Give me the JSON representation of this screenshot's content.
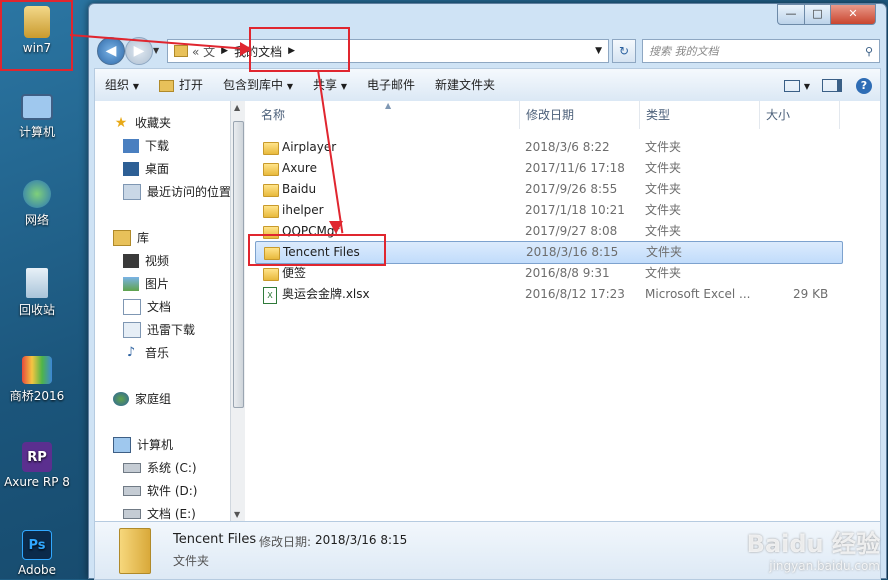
{
  "desktop": {
    "icons": [
      {
        "label": "win7",
        "icon": "user-folder-icon"
      },
      {
        "label": "计算机",
        "icon": "computer-icon"
      },
      {
        "label": "网络",
        "icon": "network-icon"
      },
      {
        "label": "回收站",
        "icon": "recycle-bin-icon"
      },
      {
        "label": "商桥2016",
        "icon": "shangqiao-icon"
      },
      {
        "label": "Axure RP 8",
        "icon": "axure-icon"
      },
      {
        "label": "Adobe",
        "icon": "adobe-icon"
      }
    ]
  },
  "window": {
    "address": {
      "prefix": "« 文",
      "current": "我的文档"
    },
    "search_placeholder": "搜索 我的文档",
    "toolbar": {
      "organize": "组织",
      "open": "打开",
      "include_library": "包含到库中",
      "share": "共享",
      "email": "电子邮件",
      "new_folder": "新建文件夹"
    },
    "nav": {
      "favorites": "收藏夹",
      "download": "下载",
      "desktop": "桌面",
      "recent": "最近访问的位置",
      "libraries": "库",
      "video": "视频",
      "pictures": "图片",
      "documents": "文档",
      "xunlei": "迅雷下载",
      "music": "音乐",
      "homegroup": "家庭组",
      "computer": "计算机",
      "drive_c": "系统 (C:)",
      "drive_d": "软件 (D:)",
      "drive_e": "文档 (E:)"
    },
    "columns": {
      "name": "名称",
      "modified": "修改日期",
      "type": "类型",
      "size": "大小"
    },
    "files": [
      {
        "name": "Airplayer",
        "date": "2018/3/6 8:22",
        "type": "文件夹",
        "size": ""
      },
      {
        "name": "Axure",
        "date": "2017/11/6 17:18",
        "type": "文件夹",
        "size": ""
      },
      {
        "name": "Baidu",
        "date": "2017/9/26 8:55",
        "type": "文件夹",
        "size": ""
      },
      {
        "name": "ihelper",
        "date": "2017/1/18 10:21",
        "type": "文件夹",
        "size": ""
      },
      {
        "name": "QQPCMgr",
        "date": "2017/9/27 8:08",
        "type": "文件夹",
        "size": ""
      },
      {
        "name": "Tencent Files",
        "date": "2018/3/16 8:15",
        "type": "文件夹",
        "size": ""
      },
      {
        "name": "便签",
        "date": "2016/8/8 9:31",
        "type": "文件夹",
        "size": ""
      },
      {
        "name": "奥运会金牌.xlsx",
        "date": "2016/8/12 17:23",
        "type": "Microsoft Excel ...",
        "size": "29 KB"
      }
    ],
    "details": {
      "name": "Tencent Files",
      "modified_label": "修改日期:",
      "modified_value": "2018/3/16 8:15",
      "type": "文件夹"
    }
  },
  "watermark": {
    "brand": "Baidu 经验",
    "url": "jingyan.baidu.com"
  },
  "colors": {
    "highlight": "#e0262f",
    "selection": "#c1dcfb"
  }
}
